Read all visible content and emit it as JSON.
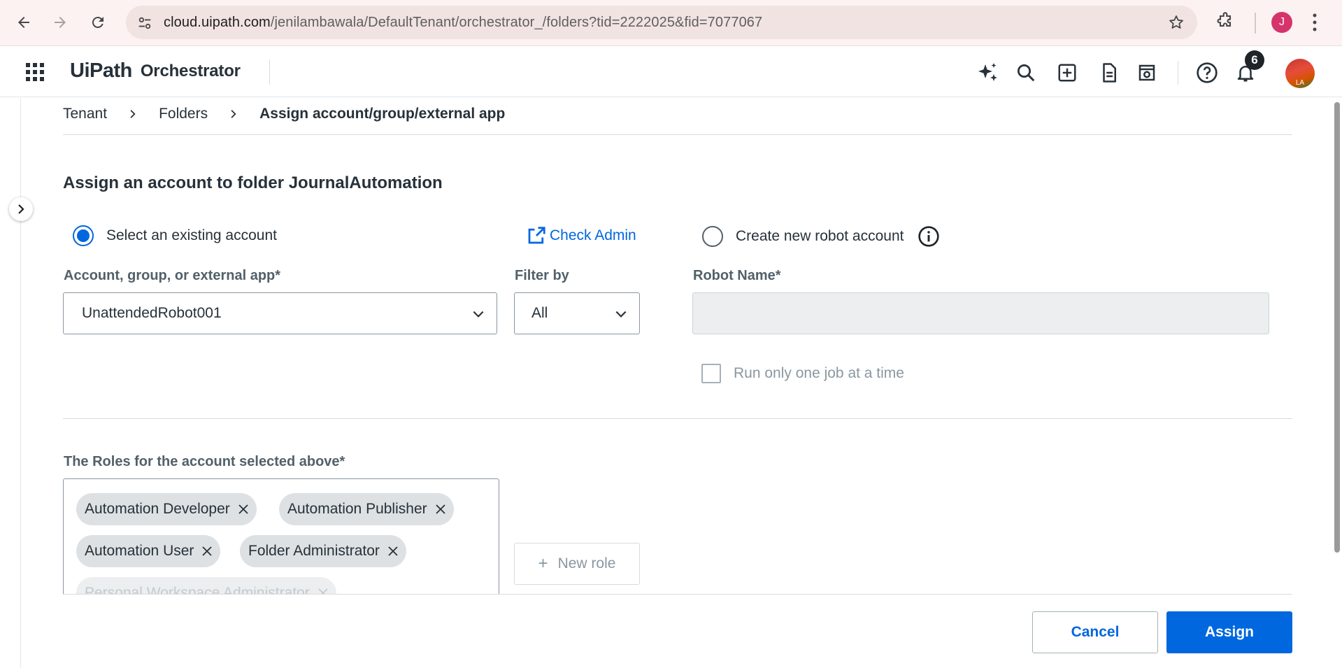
{
  "browser": {
    "url_host": "cloud.uipath.com",
    "url_path": "/jenilambawala/DefaultTenant/orchestrator_/folders?tid=2222025&fid=7077067",
    "profile_initial": "J"
  },
  "header": {
    "brand": "UiPath",
    "product": "Orchestrator",
    "notification_count": "6",
    "avatar_initials": "LA"
  },
  "breadcrumb": {
    "items": [
      "Tenant",
      "Folders",
      "Assign account/group/external app"
    ]
  },
  "form": {
    "title": "Assign an account to folder JournalAutomation",
    "radio_existing": "Select an existing account",
    "check_admin": "Check Admin",
    "radio_new": "Create new robot account",
    "account_label": "Account, group, or external app*",
    "account_value": "UnattendedRobot001",
    "filter_label": "Filter by",
    "filter_value": "All",
    "robot_name_label": "Robot Name*",
    "robot_name_value": "",
    "run_one_job": "Run only one job at a time",
    "roles_label": "The Roles for the account selected above*",
    "roles": [
      "Automation Developer",
      "Automation Publisher",
      "Automation User",
      "Folder Administrator",
      "Personal Workspace Administrator"
    ],
    "new_role": "New role"
  },
  "footer": {
    "cancel": "Cancel",
    "assign": "Assign"
  },
  "colors": {
    "accent": "#0067df",
    "text": "#273139",
    "muted": "#8a97a0"
  }
}
